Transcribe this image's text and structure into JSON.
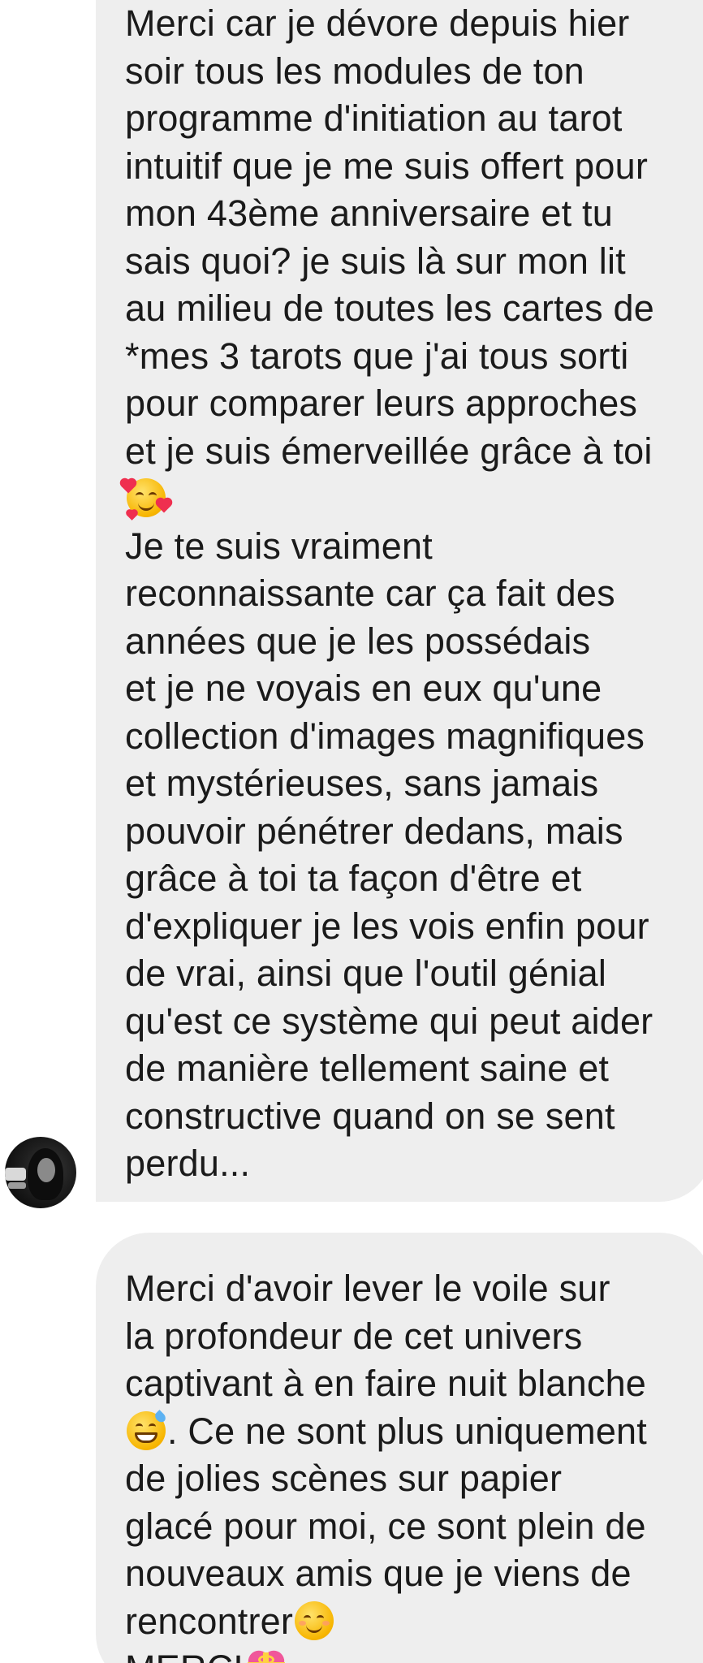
{
  "messages": [
    {
      "lines": [
        "Merci car je dévore depuis hier",
        "soir tous les modules de ton",
        "programme d'initiation au tarot",
        "intuitif que je me suis offert pour",
        "mon 43ème anniversaire et tu",
        "sais quoi? je suis là sur mon lit",
        "au milieu de toutes les cartes de",
        "*mes 3 tarots que j'ai tous sorti",
        "pour comparer leurs approches",
        "et je suis émerveillée grâce à toi",
        "",
        "Je te suis vraiment",
        "reconnaissante car ça fait des",
        "années que je les possédais",
        "et je ne voyais en eux qu'une",
        "collection d'images magnifiques",
        "et mystérieuses, sans jamais",
        "pouvoir pénétrer dedans, mais",
        "grâce à toi ta façon d'être et",
        "d'expliquer je les vois enfin pour",
        "de vrai, ainsi que l'outil génial",
        "qu'est ce système qui peut aider",
        "de manière tellement saine et",
        "constructive quand on se sent",
        "perdu..."
      ],
      "emoji": "smiling-face-with-hearts-icon"
    },
    {
      "lines": [
        "Merci d'avoir lever le voile sur",
        "la profondeur de cet univers",
        "captivant à en faire nuit blanche",
        ". Ce ne sont plus uniquement",
        "de jolies scènes sur papier",
        "glacé pour moi, ce sont plein de",
        "nouveaux amis que je viens de",
        "rencontrer",
        "MERCI"
      ],
      "emojis": [
        "grinning-face-with-sweat-icon",
        "smiling-face-icon",
        "heart-with-ribbon-icon"
      ]
    }
  ],
  "colors": {
    "bubble_background": "#eeeeee",
    "text": "#1a1a1a",
    "page_background": "#ffffff"
  }
}
